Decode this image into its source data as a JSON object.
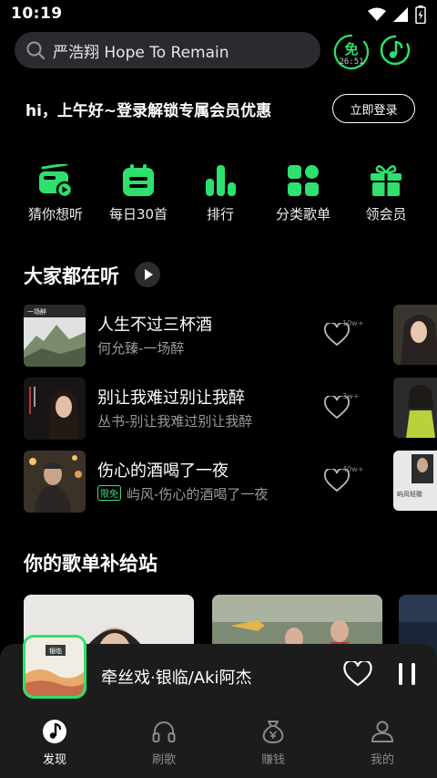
{
  "status_bar": {
    "time": "10:19",
    "icons": [
      "wifi-icon",
      "signal-icon",
      "battery-icon"
    ]
  },
  "header": {
    "search_text": "严浩翔 Hope To Remain",
    "free_badge": "免",
    "free_timer": "26:51"
  },
  "promo": {
    "text": "hi，上午好~登录解锁专属会员优惠",
    "login_label": "立即登录"
  },
  "quick_links": [
    {
      "label": "猜你想听",
      "icon": "radio-icon"
    },
    {
      "label": "每日30首",
      "icon": "calendar-icon"
    },
    {
      "label": "排行",
      "icon": "chart-bars-icon"
    },
    {
      "label": "分类歌单",
      "icon": "grid-icon"
    },
    {
      "label": "领会员",
      "icon": "gift-icon"
    }
  ],
  "section_listening": {
    "title": "大家都在听"
  },
  "songs": [
    {
      "title": "人生不过三杯酒",
      "subtitle": "何允臻-一场醉",
      "likes": "10w+",
      "cover_text": "一场醉",
      "free": false
    },
    {
      "title": "别让我难过别让我醉",
      "subtitle": "丛书-别让我难过别让我醉",
      "likes": "3w+",
      "cover_text": "",
      "free": false
    },
    {
      "title": "伤心的酒喝了一夜",
      "subtitle": "屿风-伤心的酒喝了一夜",
      "likes": "40w+",
      "cover_text": "",
      "free": true,
      "free_label": "限免"
    }
  ],
  "peek_cover_text": "屿风轻歌",
  "section_playlist": {
    "title": "你的歌单补给站"
  },
  "mini_player": {
    "title": "牵丝戏·银临/Aki阿杰",
    "cover_text": "银临"
  },
  "bottom_nav": [
    {
      "label": "发现",
      "icon": "note-icon",
      "active": true
    },
    {
      "label": "刷歌",
      "icon": "headphones-icon",
      "active": false
    },
    {
      "label": "赚钱",
      "icon": "money-bag-icon",
      "active": false
    },
    {
      "label": "我的",
      "icon": "user-icon",
      "active": false
    }
  ],
  "colors": {
    "accent": "#2ee06d",
    "background": "#000000",
    "surface": "#1c1c1c",
    "search_bg": "#2a2b2e",
    "muted": "#9a9a9a"
  }
}
